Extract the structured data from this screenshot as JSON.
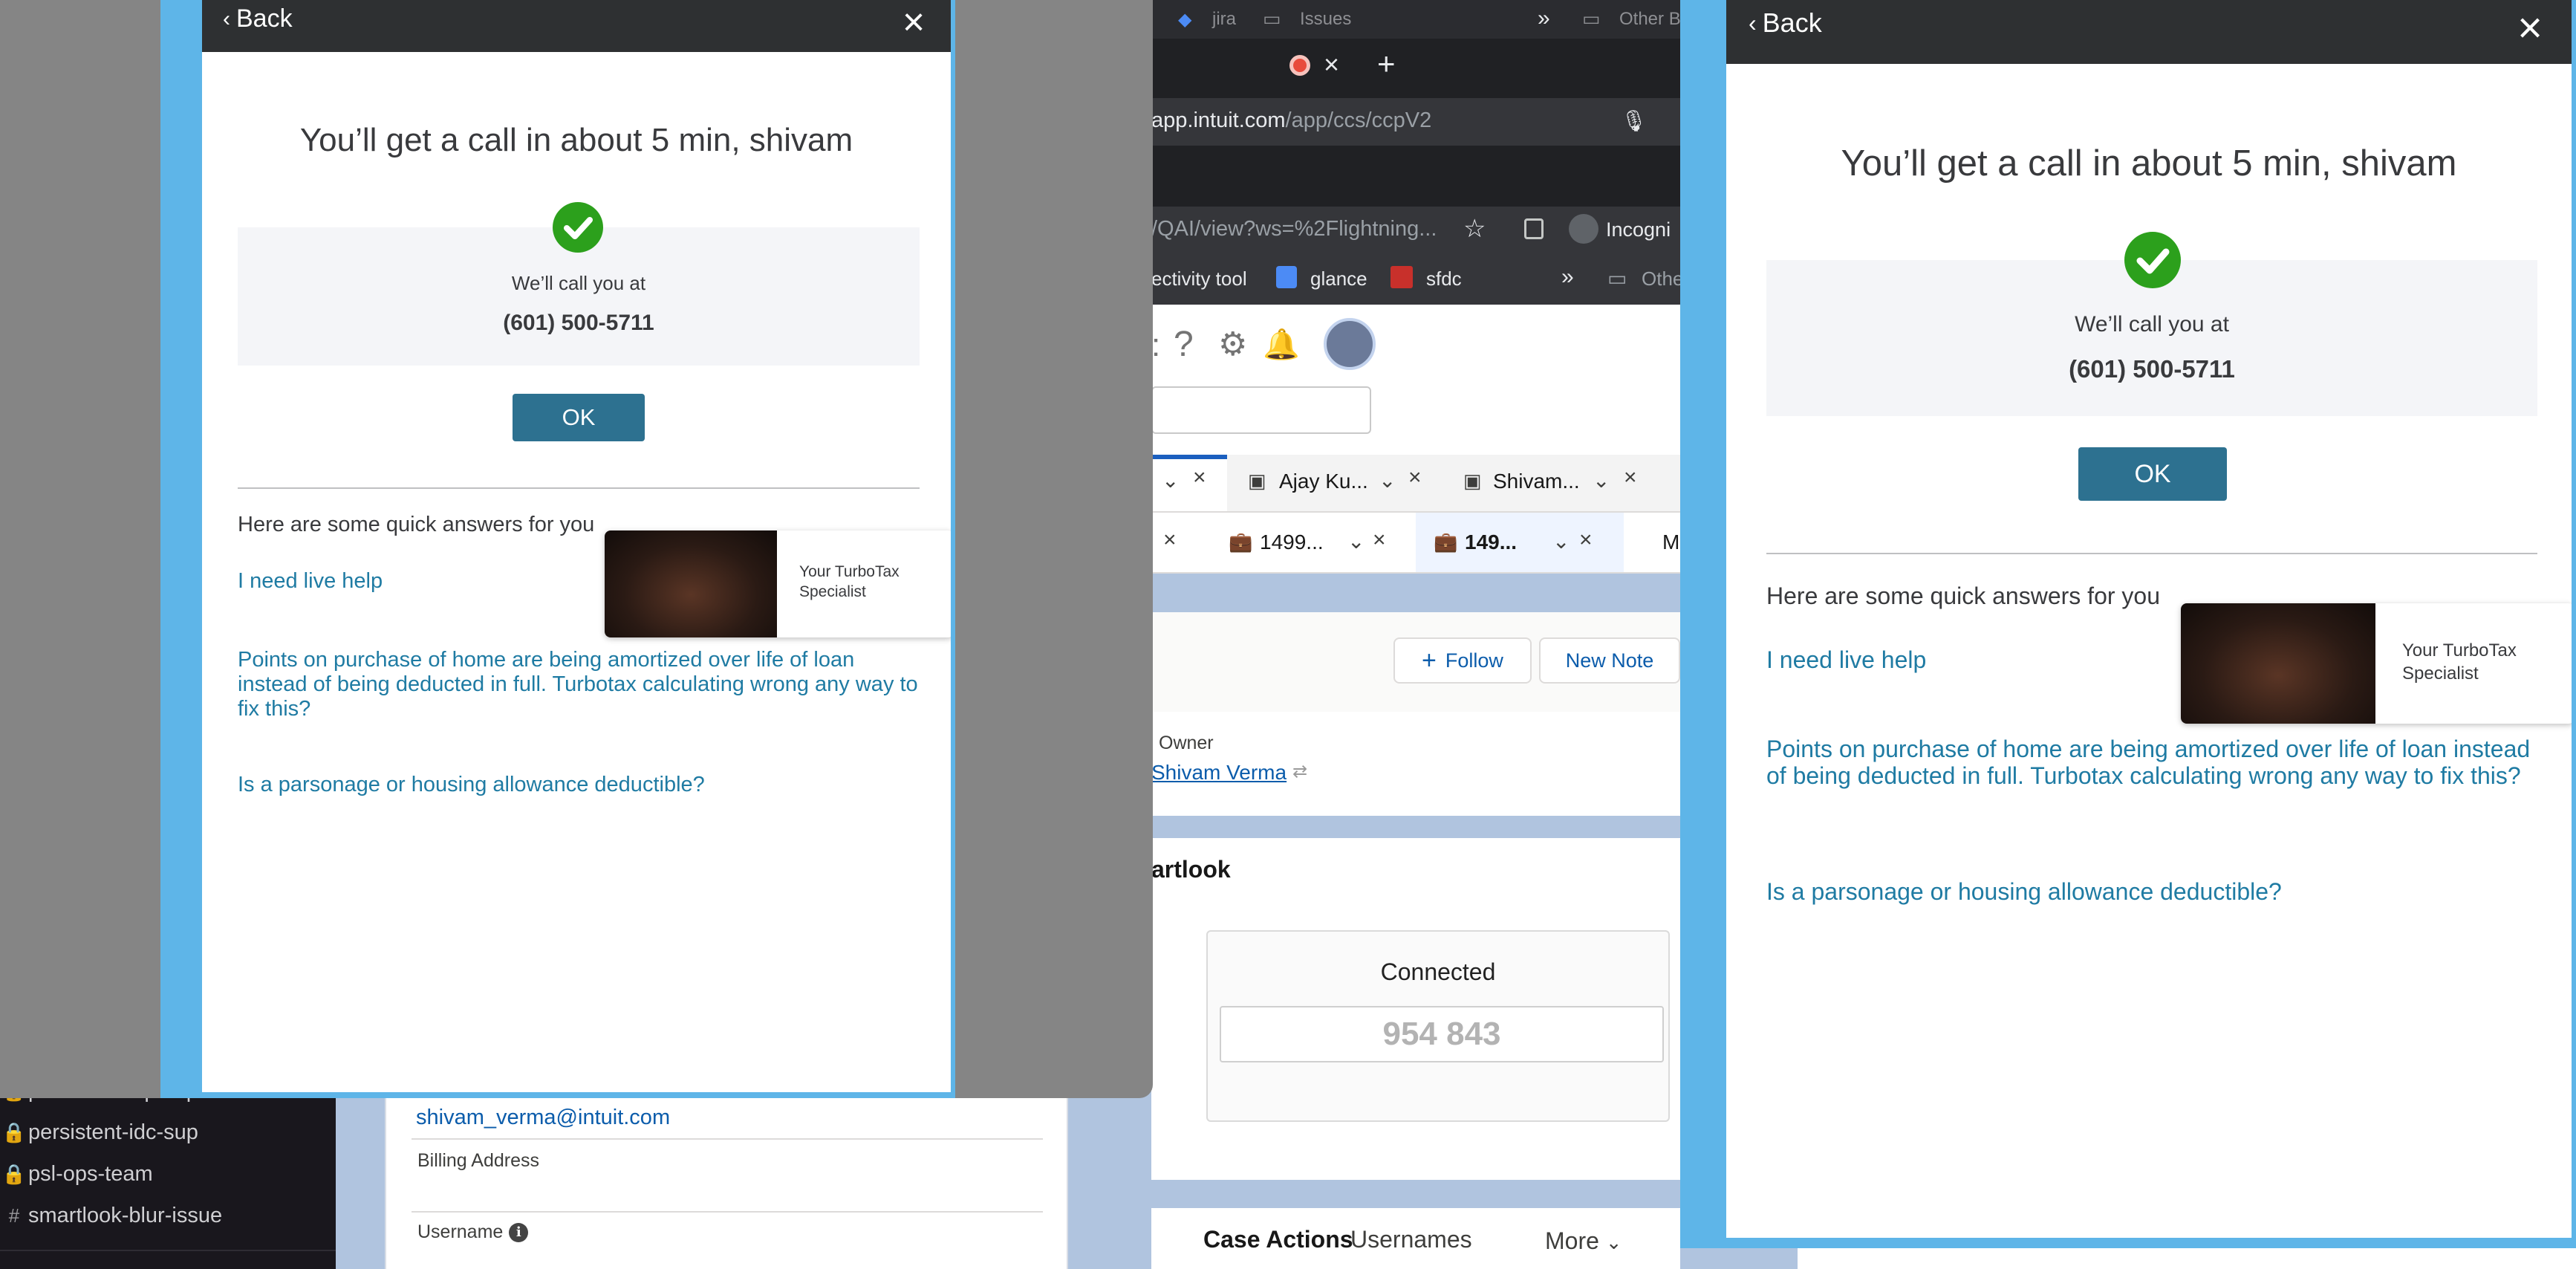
{
  "slack": {
    "channels": [
      {
        "prefix": "🔒",
        "name": "persistent-cip-sup"
      },
      {
        "prefix": "🔒",
        "name": "persistent-idc-sup"
      },
      {
        "prefix": "🔒",
        "name": "psl-ops-team"
      },
      {
        "prefix": "#",
        "name": "smartlook-blur-issue"
      }
    ]
  },
  "salesforce_detail": {
    "email": "shivam_verma@intuit.com",
    "billing_address_label": "Billing Address",
    "username_label": "Username"
  },
  "browser": {
    "bookmarks_top": {
      "jira": "jira",
      "issues": "Issues",
      "more": "»",
      "other": "Other B"
    },
    "tab_close": "×",
    "new_tab": "+",
    "url_host": "app.intuit.com",
    "url_path": "/app/ccs/ccpV2",
    "url2": "/QAI/view?ws=%2Flightning...",
    "incognito": "Incogni",
    "bookmarks": {
      "connectivity": "ectivity tool",
      "glance": "glance",
      "sfdc": "sfdc",
      "more": "»",
      "other": "Othe"
    },
    "workspace_tabs": [
      {
        "label": "Ajay Ku..."
      },
      {
        "label": "Shivam..."
      }
    ],
    "subtabs": [
      {
        "label": "1499..."
      },
      {
        "label": "149..."
      }
    ],
    "subtab_more": "M",
    "follow_label": "Follow",
    "new_note_label": "New Note",
    "owner_label": "Owner",
    "owner_name": "Shivam Verma",
    "smartlook_title": "artlook",
    "connected_label": "Connected",
    "connected_code": "954 843",
    "case_actions_label": "Case Actions",
    "usernames_label": "Usernames",
    "more_label": "More"
  },
  "widget_left": {
    "back_label": "Back",
    "close_glyph": "×",
    "headline": "You’ll get a call in about 5 min, shivam",
    "call_label": "We’ll call you at",
    "phone": "(601) 500-5711",
    "ok_label": "OK",
    "quick_answers_title": "Here are some quick answers for you",
    "links": [
      "I need live help",
      "Points on purchase of home are being amortized over life of loan instead of being deducted in full. Turbotax calculating wrong any way to fix this?",
      "Is a parsonage or housing allowance deductible?"
    ],
    "video_label": "Your TurboTax Specialist"
  },
  "widget_right": {
    "back_label": "Back",
    "close_glyph": "×",
    "headline": "You’ll get a call in about 5 min, shivam",
    "call_label": "We’ll call you at",
    "phone": "(601) 500-5711",
    "ok_label": "OK",
    "quick_answers_title": "Here are some quick answers for you",
    "links": [
      "I need live help",
      "Points on purchase of home are being amortized over life of loan instead of being deducted in full. Turbotax calculating wrong any way to fix this?",
      "Is a parsonage or housing allowance deductible?"
    ],
    "video_label": "Your TurboTax Specialist"
  },
  "colors": {
    "accent_link": "#1f7ba3",
    "ok_button": "#2d7190",
    "check_green": "#2ca01c",
    "header_dark": "#2e3032",
    "frame_blue": "#5eb5e8"
  }
}
